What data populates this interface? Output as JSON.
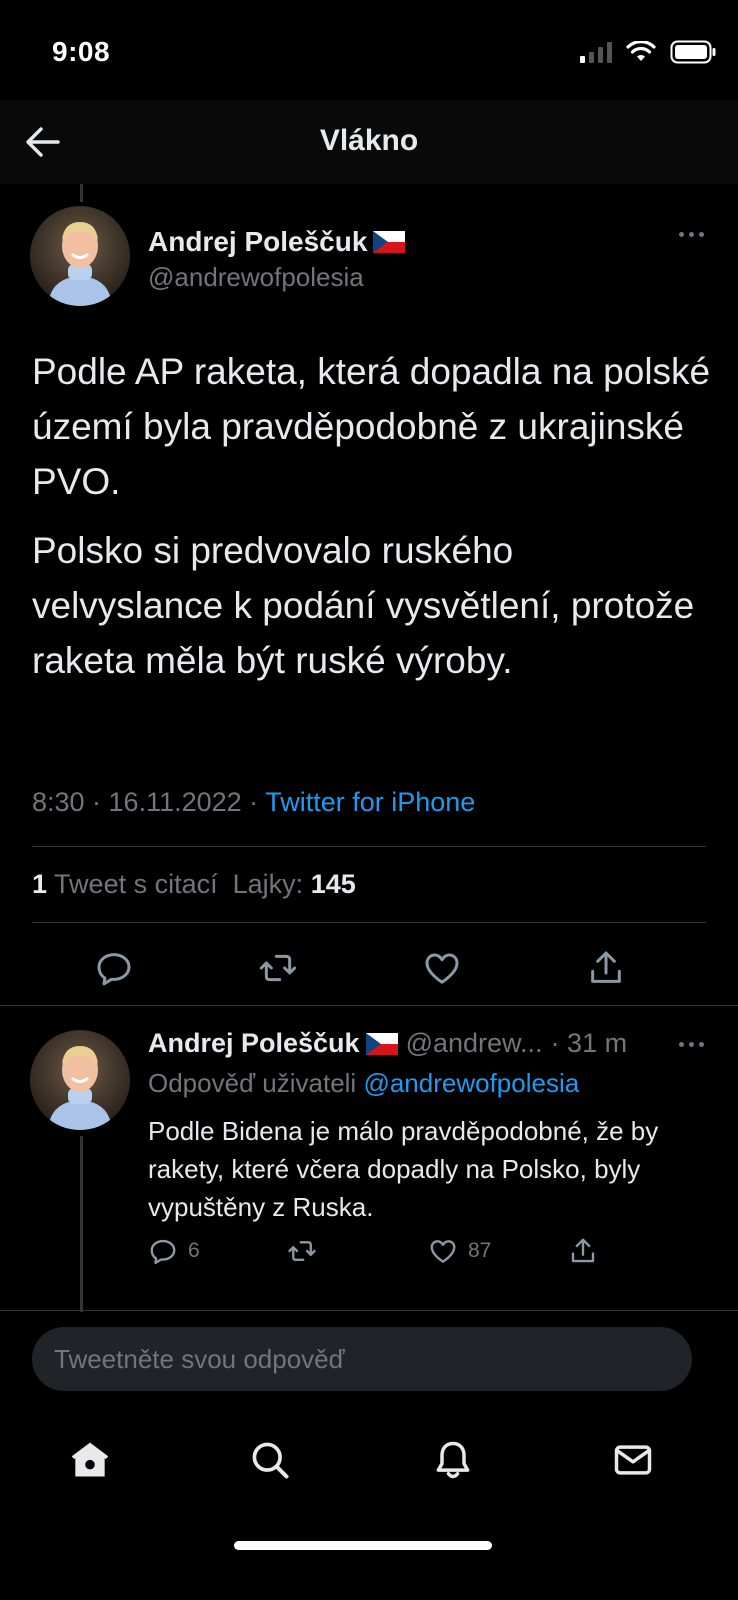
{
  "status_bar": {
    "time": "9:08"
  },
  "nav": {
    "title": "Vlákno"
  },
  "tweet": {
    "author_name": "Andrej Poleščuk",
    "author_handle": "@andrewofpolesia",
    "flag": "czech-flag",
    "paragraphs": [
      "Podle AP raketa, která dopadla na polské území byla pravděpodobně z ukrajinské PVO.",
      "Polsko si predvovalo ruského velvyslance k podání vysvětlení, protože raketa měla být ruské výroby."
    ],
    "timestamp": "8:30 · 16.11.2022 · ",
    "source": "Twitter for iPhone",
    "quote_count": "1",
    "quote_label": " Tweet s citací",
    "likes_label": "Lajky:",
    "likes_count": "145"
  },
  "reply": {
    "author_name": "Andrej Poleščuk",
    "author_handle": "@andrew...",
    "time": "· 31 m",
    "reply_to_label": "Odpověď uživateli",
    "reply_to_handle": "@andrewofpolesia",
    "text": "Podle Bidena je málo pravděpodobné, že by rakety, které včera dopadly na Polsko, byly vypuštěny z Ruska.",
    "reply_count": "6",
    "like_count": "87"
  },
  "compose": {
    "placeholder": "Tweetněte svou odpověď"
  },
  "colors": {
    "accent": "#1d9bf0",
    "text": "#e7e9ea",
    "muted": "#71767b",
    "background": "#000000"
  }
}
